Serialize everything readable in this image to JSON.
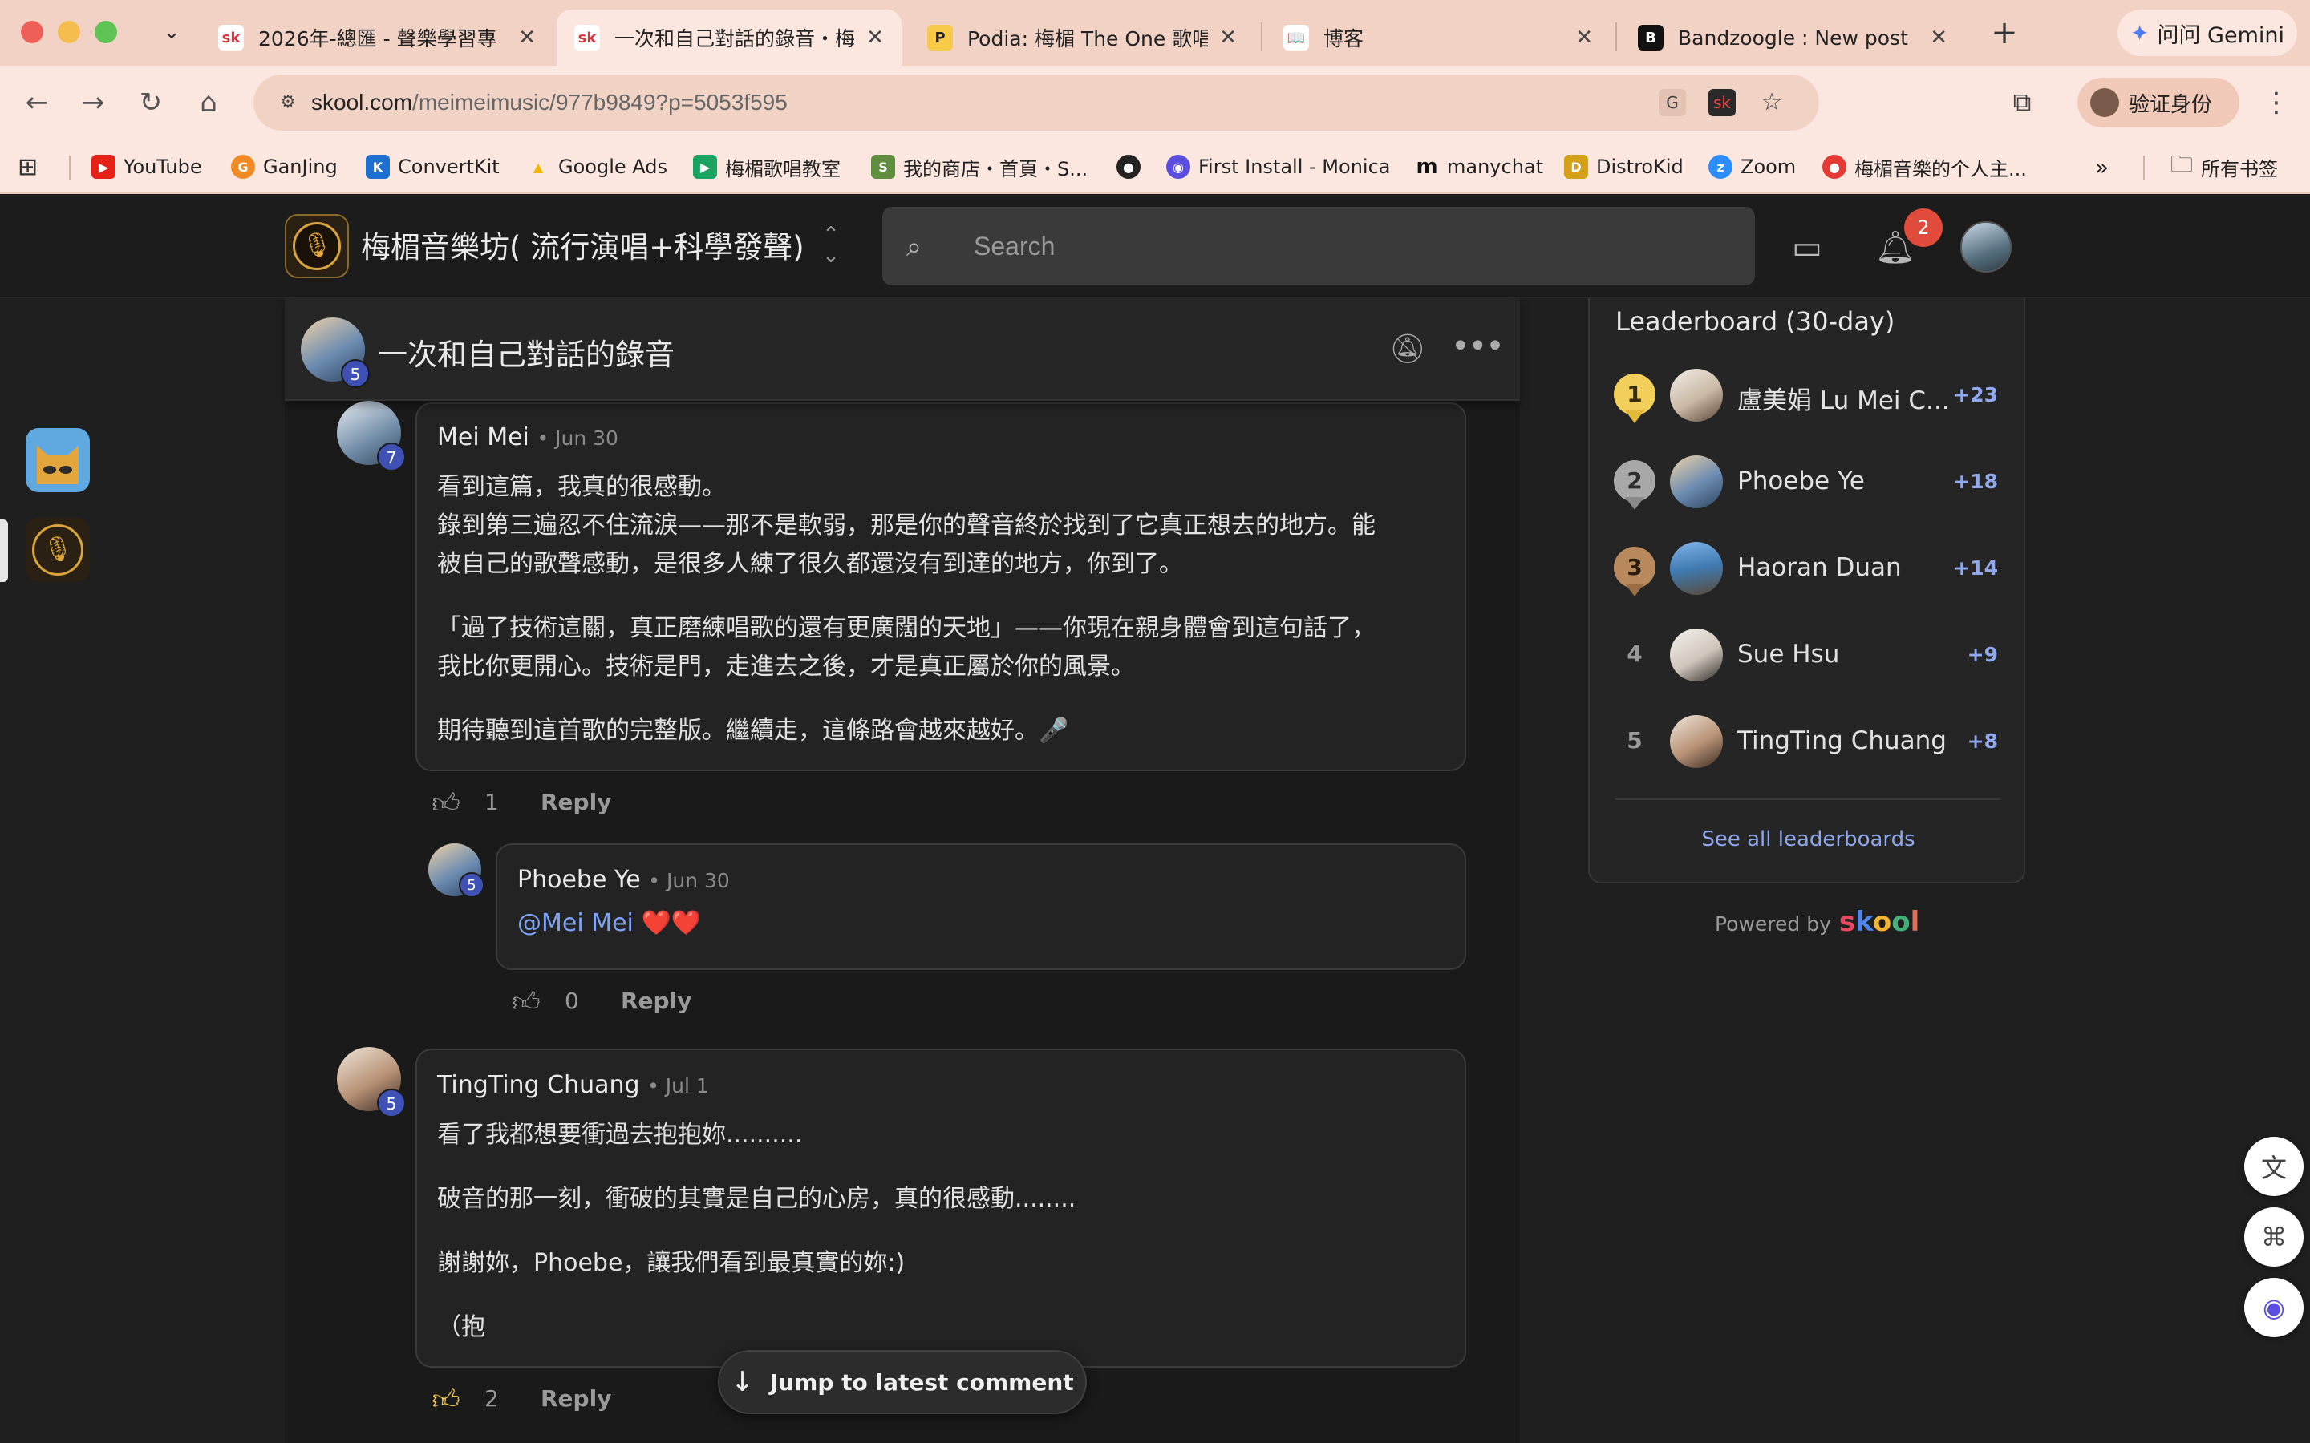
{
  "browser": {
    "tabs": [
      {
        "favicon": "sk",
        "title": "2026年-總匯 - 聲樂學習專",
        "close": "✕"
      },
      {
        "favicon": "sk",
        "title": "一次和自己對話的錄音・梅",
        "close": "✕"
      },
      {
        "favicon": "P",
        "title": "Podia: 梅楣 The One 歌唱",
        "close": "✕"
      },
      {
        "favicon": "📖",
        "title": "博客",
        "close": "✕"
      },
      {
        "favicon": "B",
        "title": "Bandzoogle : New post",
        "close": "✕"
      }
    ],
    "new_tab": "+",
    "gemini_label": "问问 Gemini",
    "url_host": "skool.com",
    "url_path": "/meimeimusic/977b9849?p=5053f595",
    "profile_label": "验证身份",
    "bookmarks": [
      {
        "icon": "youtube-icon",
        "label": "YouTube",
        "color": "#e62117",
        "glyph": "▶"
      },
      {
        "icon": "ganjing-icon",
        "label": "GanJing",
        "color": "#f08a24",
        "glyph": "G"
      },
      {
        "icon": "convertkit-icon",
        "label": "ConvertKit",
        "color": "#1f6fd1",
        "glyph": "K"
      },
      {
        "icon": "google-ads-icon",
        "label": "Google Ads",
        "color": "#f2b705",
        "glyph": "▲"
      },
      {
        "icon": "meet-icon",
        "label": "梅楣歌唱教室",
        "color": "#1aa260",
        "glyph": "▶"
      },
      {
        "icon": "shopify-icon",
        "label": "我的商店・首頁・S...",
        "color": "#5e8e3e",
        "glyph": "S"
      },
      {
        "icon": "globe-icon",
        "label": "",
        "color": "#222222",
        "glyph": "●"
      },
      {
        "icon": "monica-icon",
        "label": "First Install - Monica",
        "color": "#5b4ee0",
        "glyph": "◉"
      },
      {
        "icon": "manychat-icon",
        "label": "manychat",
        "color": "#111111",
        "glyph": "m"
      },
      {
        "icon": "distrokid-icon",
        "label": "DistroKid",
        "color": "#d4a017",
        "glyph": "D"
      },
      {
        "icon": "zoom-icon",
        "label": "Zoom",
        "color": "#2d8cff",
        "glyph": "z"
      },
      {
        "icon": "music-site-icon",
        "label": "梅楣音樂的个人主...",
        "color": "#e53935",
        "glyph": "●"
      }
    ],
    "bookmarks_more": "»",
    "all_bookmarks": "所有书签"
  },
  "skool": {
    "group_name": "梅楣音樂坊( 流行演唱+科學發聲)",
    "search_placeholder": "Search",
    "notifications_count": "2"
  },
  "post": {
    "title": "一次和自己對話的錄音",
    "author_level": "5"
  },
  "comments": [
    {
      "author": "Mei Mei",
      "date": "• Jun 30",
      "level": "7",
      "lines": [
        "看到這篇，我真的很感動。",
        "錄到第三遍忍不住流淚——那不是軟弱，那是你的聲音終於找到了它真正想去的地方。能",
        "被自己的歌聲感動，是很多人練了很久都還沒有到達的地方，你到了。",
        "「過了技術這關，真正磨練唱歌的還有更廣闊的天地」——你現在親身體會到這句話了，",
        "我比你更開心。技術是門，走進去之後，才是真正屬於你的風景。",
        "期待聽到這首歌的完整版。繼續走，這條路會越來越好。🎤"
      ],
      "likes": "1",
      "reply_label": "Reply"
    },
    {
      "author": "Phoebe Ye",
      "date": "• Jun 30",
      "level": "5",
      "mention": "@Mei Mei",
      "emoji": "❤️❤️",
      "likes": "0",
      "reply_label": "Reply"
    },
    {
      "author": "TingTing Chuang",
      "date": "• Jul 1",
      "level": "5",
      "lines": [
        "看了我都想要衝過去抱抱妳..........",
        "破音的那一刻，衝破的其實是自己的心房，真的很感動........",
        "謝謝妳，Phoebe，讓我們看到最真實的妳:)",
        "（抱"
      ],
      "likes": "2",
      "reply_label": "Reply"
    }
  ],
  "jump_label": "Jump to latest comment",
  "leaderboard": {
    "title": "Leaderboard (30-day)",
    "entries": [
      {
        "rank": "1",
        "name": "盧美娟 Lu Mei C...",
        "points": "+23"
      },
      {
        "rank": "2",
        "name": "Phoebe Ye",
        "points": "+18"
      },
      {
        "rank": "3",
        "name": "Haoran Duan",
        "points": "+14"
      },
      {
        "rank": "4",
        "name": "Sue Hsu",
        "points": "+9"
      },
      {
        "rank": "5",
        "name": "TingTing Chuang",
        "points": "+8"
      }
    ],
    "see_all": "See all leaderboards",
    "powered_by": "Powered by",
    "brand": "skool"
  },
  "colors": {
    "accent_link": "#8fa8ee",
    "mention": "#7fa3f5",
    "badge_red": "#e04b3c",
    "level_blue": "#3f51b5",
    "liked_yellow": "#f5c84c"
  }
}
